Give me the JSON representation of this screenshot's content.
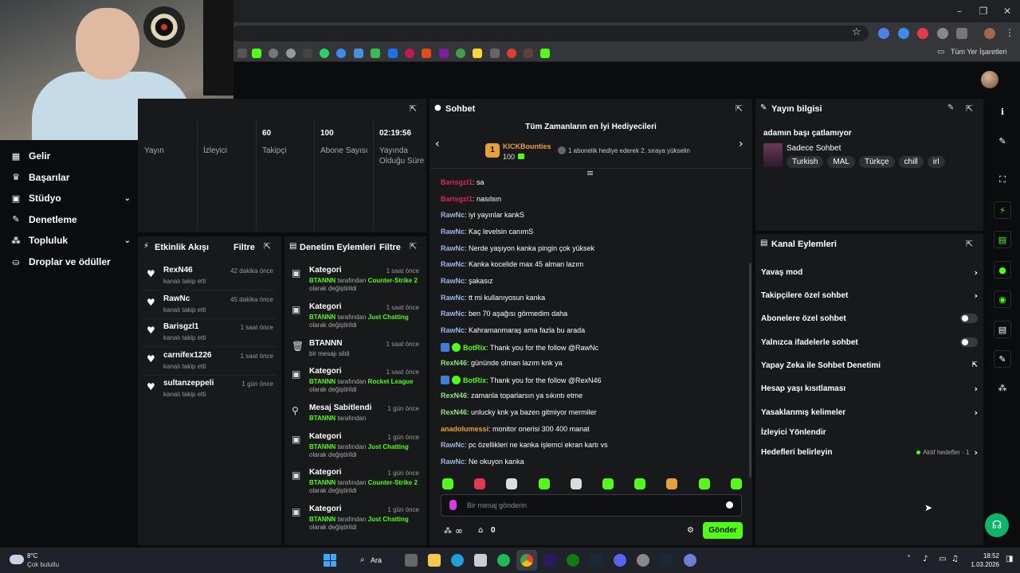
{
  "browser": {
    "bookmark_folder": "Tüm Yer İşaretleri"
  },
  "nav": {
    "items": [
      {
        "label": "Gelir",
        "icon": "revenue-icon",
        "has_chevron": false
      },
      {
        "label": "Başarılar",
        "icon": "achievements-icon",
        "has_chevron": false
      },
      {
        "label": "Stüdyo",
        "icon": "studio-icon",
        "has_chevron": true
      },
      {
        "label": "Denetleme",
        "icon": "moderation-icon",
        "has_chevron": false
      },
      {
        "label": "Topluluk",
        "icon": "community-icon",
        "has_chevron": true
      },
      {
        "label": "Droplar ve ödüller",
        "icon": "drops-icon",
        "has_chevron": false
      }
    ]
  },
  "stats": {
    "items": [
      {
        "value": "",
        "label": "Yayın"
      },
      {
        "value": "",
        "label": "İzleyici"
      },
      {
        "value": "60",
        "label": "Takipçi"
      },
      {
        "value": "100",
        "label": "Abone Sayısı"
      },
      {
        "value": "02:19:56",
        "label": "Yayında Olduğu Süre"
      }
    ]
  },
  "activity": {
    "title": "Etkinlik Akışı",
    "filter": "Filtre",
    "items": [
      {
        "name": "RexN46",
        "sub": "kanalı takip etti",
        "time": "42 dakika önce"
      },
      {
        "name": "RawNc",
        "sub": "kanalı takip etti",
        "time": "45 dakika önce"
      },
      {
        "name": "Barisgzl1",
        "sub": "kanalı takip etti",
        "time": "1 saat önce"
      },
      {
        "name": "carnifex1226",
        "sub": "kanalı takip etti",
        "time": "1 saat önce"
      },
      {
        "name": "sultanzeppeli",
        "sub": "kanalı takip etti",
        "time": "1 gün önce"
      }
    ]
  },
  "modlog": {
    "title": "Denetim Eylemleri",
    "filter": "Filtre",
    "items": [
      {
        "title": "Kategori",
        "time": "1 saat önce",
        "actor": "BTANNN",
        "mid": " tarafından ",
        "target": "Counter-Strike 2",
        "tail": " olarak değiştirildi"
      },
      {
        "title": "Kategori",
        "time": "1 saat önce",
        "actor": "BTANNN",
        "mid": " tarafından ",
        "target": "Just Chatting",
        "tail": " olarak değiştirildi"
      },
      {
        "title": "BTANNN",
        "time": "1 saat önce",
        "actor": "",
        "mid": "bir mesajı sildi",
        "target": "",
        "tail": ""
      },
      {
        "title": "Kategori",
        "time": "1 saat önce",
        "actor": "BTANNN",
        "mid": " tarafından ",
        "target": "Rocket League",
        "tail": " olarak değiştirildi"
      },
      {
        "title": "Mesaj Sabitlendi",
        "time": "1 gün önce",
        "actor": "BTANNN",
        "mid": " tarafından",
        "target": "",
        "tail": ""
      },
      {
        "title": "Kategori",
        "time": "1 gün önce",
        "actor": "BTANNN",
        "mid": " tarafından ",
        "target": "Just Chatting",
        "tail": " olarak değiştirildi"
      },
      {
        "title": "Kategori",
        "time": "1 gün önce",
        "actor": "BTANNN",
        "mid": " tarafından ",
        "target": "Counter-Strike 2",
        "tail": " olarak değiştirildi"
      },
      {
        "title": "Kategori",
        "time": "1 gün önce",
        "actor": "BTANNN",
        "mid": " tarafından ",
        "target": "Just Chatting",
        "tail": " olarak değiştirildi"
      }
    ]
  },
  "chat": {
    "title": "Sohbet",
    "banner_title": "Tüm Zamanların en İyi Hediyecileri",
    "top_gifter": "KICKBounties",
    "top_gifter_count": "100",
    "rank": "1",
    "promo": "1 abonelik hediye ederek 2. sıraya yükselin",
    "messages": [
      {
        "user": "Barisgzl1",
        "color": "pink",
        "bot": false,
        "text": "sa"
      },
      {
        "user": "Barisgzl1",
        "color": "pink",
        "bot": false,
        "text": "nasılsın"
      },
      {
        "user": "RawNc",
        "color": "blue",
        "bot": false,
        "text": "iyi yayınlar kankS"
      },
      {
        "user": "RawNc",
        "color": "blue",
        "bot": false,
        "text": "Kaç levelsin canımS"
      },
      {
        "user": "RawNc",
        "color": "blue",
        "bot": false,
        "text": "Nerde yaşıyon kanka pingin çok yüksek"
      },
      {
        "user": "RawNc",
        "color": "blue",
        "bot": false,
        "text": "Kanka kocelide max 45 alman lazım"
      },
      {
        "user": "RawNc",
        "color": "blue",
        "bot": false,
        "text": "şakasız"
      },
      {
        "user": "RawNc",
        "color": "blue",
        "bot": false,
        "text": "tt mi kullanıyosun kanka"
      },
      {
        "user": "RawNc",
        "color": "blue",
        "bot": false,
        "text": "ben 70 aşağısı görmedim daha"
      },
      {
        "user": "RawNc",
        "color": "blue",
        "bot": false,
        "text": "Kahramanmaraş ama fazla bu arada"
      },
      {
        "user": "BotRix",
        "color": "bot",
        "bot": true,
        "text": "Thank you for the follow @RawNc"
      },
      {
        "user": "RexN46",
        "color": "green",
        "bot": false,
        "text": "gününde olman lazım knk ya"
      },
      {
        "user": "BotRix",
        "color": "bot",
        "bot": true,
        "text": "Thank you for the follow @RexN46"
      },
      {
        "user": "RexN46",
        "color": "green",
        "bot": false,
        "text": "zamanla toparlarsın ya sıkıntı etme"
      },
      {
        "user": "RexN46",
        "color": "green",
        "bot": false,
        "text": "unlucky knk ya bazen gitmiyor mermiler"
      },
      {
        "user": "anadolumessi",
        "color": "orange",
        "bot": false,
        "text": "monitor onerisi 300 400 manat"
      },
      {
        "user": "RawNc",
        "color": "blue",
        "bot": false,
        "text": "pc özellikleri ne kanka işlemci ekran kartı vs"
      },
      {
        "user": "RawNc",
        "color": "blue",
        "bot": false,
        "text": "Ne okuyon kanka"
      }
    ],
    "input_placeholder": "Bir mesaj gönderin",
    "send_label": "Gönder",
    "points": "0",
    "infinity": "∞"
  },
  "stream_info": {
    "title": "Yayın bilgisi",
    "stream_title": "adamın başı çatlamıyor",
    "category": "Sadece Sohbet",
    "tags": [
      "Turkish",
      "MAL",
      "Türkçe",
      "chill",
      "irl"
    ]
  },
  "channel_actions": {
    "title": "Kanal Eylemleri",
    "items": [
      {
        "label": "Yavaş mod",
        "control": "chevron"
      },
      {
        "label": "Takipçilere özel sohbet",
        "control": "chevron"
      },
      {
        "label": "Abonelere özel sohbet",
        "control": "toggle"
      },
      {
        "label": "Yalnızca ifadelerle sohbet",
        "control": "toggle"
      },
      {
        "label": "Yapay Zeka ile Sohbet Denetimi",
        "control": "external"
      },
      {
        "label": "Hesap yaşı kısıtlaması",
        "control": "chevron"
      },
      {
        "label": "Yasaklanmış kelimeler",
        "control": "chevron"
      },
      {
        "label": "İzleyici Yönlendir",
        "control": "none"
      },
      {
        "label": "Hedefleri belirleyin",
        "control": "chevron"
      }
    ],
    "goals_status": "Aktif hedefler - 1"
  },
  "taskbar": {
    "weather_temp": "8°C",
    "weather_desc": "Çok bulutlu",
    "search": "Ara",
    "time": "18:52",
    "date": "1.03.2026"
  },
  "colors": {
    "accent": "#53fc18",
    "panel": "#18191b",
    "background": "#0b0c0e"
  }
}
